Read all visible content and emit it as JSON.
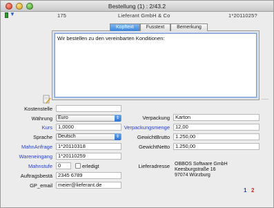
{
  "window": {
    "title": "Bestellung (1) : 2/43.2"
  },
  "toolbar": {
    "doc_no": "175",
    "supplier": "Lieferant GmbH & Co",
    "ref": "1*2011025?"
  },
  "tabs": [
    "Kopftext",
    "Fusstext",
    "Bemerkung"
  ],
  "kopftext": "Wir bestellen zu den vereinbarten Konditionen:",
  "left": {
    "kostenstelle_label": "Kostenstelle",
    "kostenstelle_value": "",
    "waehrung_label": "Währung",
    "waehrung_value": "Euro",
    "kurs_label": "Kurs",
    "kurs_value": "1,0000",
    "sprache_label": "Sprache",
    "sprache_value": "Deutsch",
    "mahnanfrage_label": "MahnAnfrage",
    "mahnanfrage_value": "1*20110318",
    "wareneingang_label": "Wareneingang",
    "wareneingang_value": "1*20110259",
    "mahnstufe_label": "Mahnstufe",
    "mahnstufe_value": "0",
    "erledigt_label": "erledigt",
    "auftragsbestae_label": "Auftragsbestä",
    "auftragsbestae_value": "2345 6789",
    "gp_email_label": "GP_email",
    "gp_email_value": "meier@lieferant.de"
  },
  "right": {
    "verpackung_label": "Verpackung",
    "verpackung_value": "Karton",
    "verpackungsmenge_label": "Verpackungsmenge",
    "verpackungsmenge_value": "12,00",
    "gewicht_brutto_label": "GewichtBrutto",
    "gewicht_brutto_value": "1.250,00",
    "gewicht_netto_label": "GewichtNetto",
    "gewicht_netto_value": "1.250,00",
    "lieferadresse_label": "Lieferadresse",
    "lieferadresse_lines": [
      "OBBOS Software GmbH",
      "Keesburgstraße 16",
      "97074 Würzburg"
    ]
  },
  "pager": {
    "page1": "1",
    "page2": "2"
  },
  "colors": {
    "link_label": "#2a3fc2",
    "active_tab": "#3d84d8",
    "pager1": "#2a3fc2",
    "pager2": "#d42020"
  },
  "icons": {
    "flag": "green-flag-icon",
    "arrow": "blue-arrow-icon",
    "note": "note-pencil-icon",
    "select": "chevron-updown-icon"
  }
}
